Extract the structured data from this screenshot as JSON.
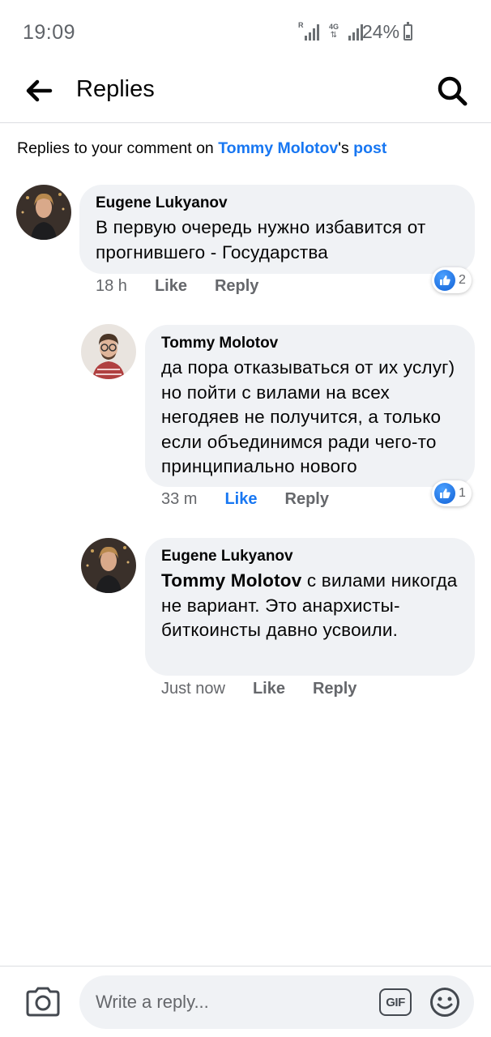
{
  "status_bar": {
    "time": "19:09",
    "network_label": "4G",
    "roaming_label": "R",
    "battery": "24%"
  },
  "app_bar": {
    "title": "Replies",
    "back_icon": "arrow-left-icon",
    "search_icon": "search-icon"
  },
  "context": {
    "prefix": "Replies to your comment on ",
    "user": "Tommy Molotov",
    "possessive": "'s ",
    "post": "post"
  },
  "comments": [
    {
      "author": "Eugene Lukyanov",
      "text": "В первую очередь нужно избавится от прогнившего - Государства",
      "time": "18 h",
      "like": "Like",
      "reply": "Reply",
      "likes": "2",
      "liked_by_me": false
    },
    {
      "author": "Tommy Molotov",
      "text": "да пора отказываться от их услуг) но пойти с вилами на всех негодяев не получится, а только если объединимся ради чего-то принципиально нового",
      "time": "33 m",
      "like": "Like",
      "reply": "Reply",
      "likes": "1",
      "liked_by_me": true
    },
    {
      "author": "Eugene Lukyanov",
      "mention": "Tommy Molotov",
      "text": " с вилами никогда не вариант. Это анархисты-биткоинсты давно усвоили.",
      "time": "Just now",
      "like": "Like",
      "reply": "Reply",
      "liked_by_me": false
    }
  ],
  "composer": {
    "placeholder": "Write a reply...",
    "gif_label": "GIF",
    "camera_icon": "camera-icon",
    "emoji_icon": "smiley-icon"
  },
  "colors": {
    "accent": "#1877f2",
    "bubble": "#f0f2f5",
    "secondary_text": "#65676b"
  }
}
